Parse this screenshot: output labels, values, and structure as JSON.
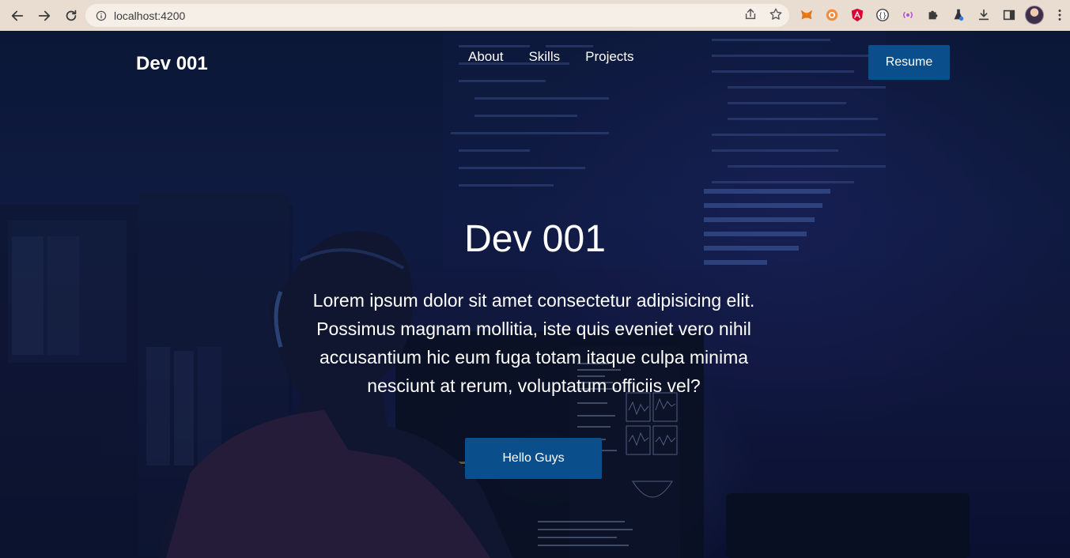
{
  "browser": {
    "url": "localhost:4200",
    "icons": {
      "back": "arrow-left-icon",
      "forward": "arrow-right-icon",
      "reload": "reload-icon",
      "site_info": "info-icon",
      "share": "share-icon",
      "bookmark": "star-icon",
      "extensions": [
        "metamask-icon",
        "extension-orange-icon",
        "angular-icon",
        "extension-bracket-icon",
        "extension-broadcast-icon",
        "puzzle-icon",
        "flask-icon",
        "download-icon",
        "sidepanel-icon",
        "avatar",
        "menu-icon"
      ]
    }
  },
  "nav": {
    "brand": "Dev 001",
    "links": [
      "About",
      "Skills",
      "Projects"
    ],
    "resume_label": "Resume"
  },
  "hero": {
    "title": "Dev 001",
    "text": "Lorem ipsum dolor sit amet consectetur adipisicing elit. Possimus magnam mollitia, iste quis eveniet vero nihil accusantium hic eum fuga totam itaque culpa minima nesciunt at rerum, voluptatum officiis vel?",
    "button_label": "Hello Guys"
  },
  "colors": {
    "accent": "#0a4f8c",
    "background": "#13204a"
  }
}
